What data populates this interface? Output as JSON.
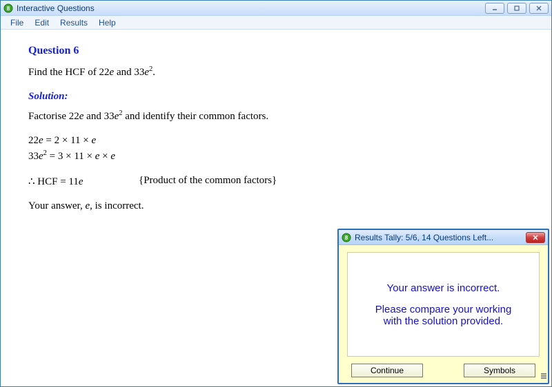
{
  "window": {
    "title": "Interactive Questions"
  },
  "menu": {
    "file": "File",
    "edit": "Edit",
    "results": "Results",
    "help": "Help"
  },
  "question": {
    "title": "Question 6",
    "text_prefix": "Find the HCF of ",
    "term1_coef": "22",
    "and": " and ",
    "term2_coef": "33",
    "period": ".",
    "solution_label": "Solution:",
    "factorise_prefix": "Factorise ",
    "factorise_suffix": " and identify their common factors.",
    "line1_lhs": "22",
    "line1_rhs": " = 2 × 11 × ",
    "line2_lhs": "33",
    "line2_rhs": " = 3 × 11 × ",
    "times": " × ",
    "therefore": "∴",
    "hcf_prefix": " HCF = 11",
    "hcf_note": "{Product of the common factors}",
    "feedback_prefix": "Your answer, ",
    "feedback_var": "e",
    "feedback_suffix": ", is incorrect."
  },
  "tally": {
    "title": "Results Tally:  5/6, 14 Questions Left...",
    "msg1": "Your answer is incorrect.",
    "msg2a": "Please compare your working",
    "msg2b": "with the solution provided.",
    "continue": "Continue",
    "symbols": "Symbols"
  }
}
